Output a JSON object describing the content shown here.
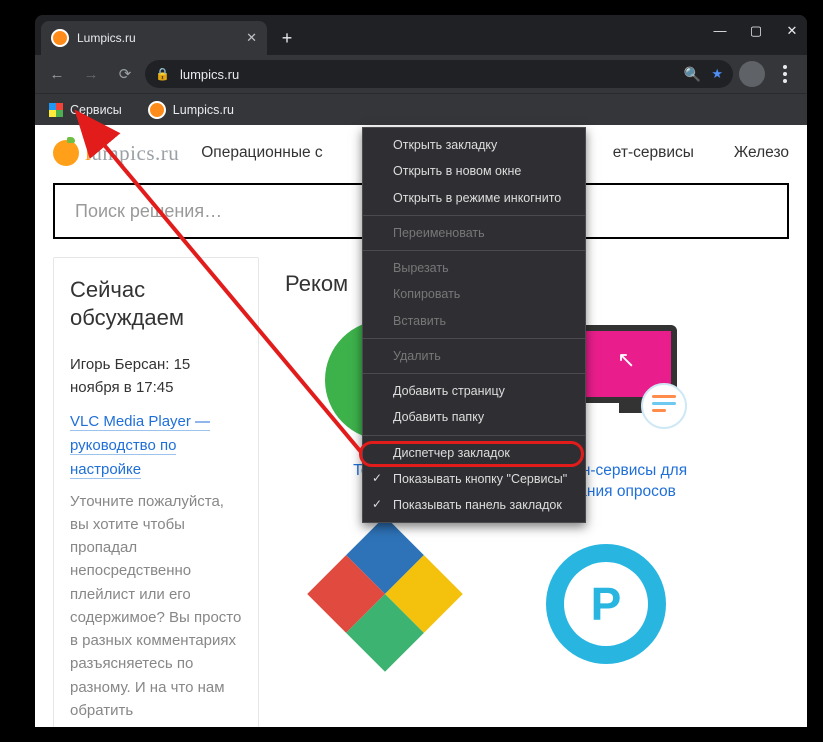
{
  "tab": {
    "title": "Lumpics.ru"
  },
  "address": {
    "url": "lumpics.ru"
  },
  "bookmarks_bar": {
    "services": "Сервисы",
    "lumpics": "Lumpics.ru"
  },
  "site": {
    "logo_a": "l",
    "logo_b": "umpics.ru",
    "menu": {
      "os": "Операционные с",
      "inet": "ет-сервисы",
      "hw": "Железо"
    },
    "search_placeholder": "Поиск решения…",
    "discuss": {
      "heading": "Сейчас обсуждаем",
      "author_date": "Игорь Берсан: 15 ноября в 17:45",
      "link": "VLC Media Player — руководство по настройке",
      "body": "Уточните пожалуйста, вы хотите чтобы пропадал непосредственно плейлист или его содержимое? Вы просто в разных комментариях разъясняетесь по разному. И на что нам обратить"
    },
    "reco": {
      "heading": "Реком",
      "c1": "Testograf",
      "c2": "Онлайн-сервисы для создания опросов"
    }
  },
  "contextmenu": {
    "open": "Открыть закладку",
    "open_new": "Открыть в новом окне",
    "open_incognito": "Открыть в режиме инкогнито",
    "rename": "Переименовать",
    "cut": "Вырезать",
    "copy": "Копировать",
    "paste": "Вставить",
    "delete": "Удалить",
    "add_page": "Добавить страницу",
    "add_folder": "Добавить папку",
    "bookmark_mgr": "Диспетчер закладок",
    "show_services": "Показывать кнопку \"Сервисы\"",
    "show_bar": "Показывать панель закладок"
  }
}
